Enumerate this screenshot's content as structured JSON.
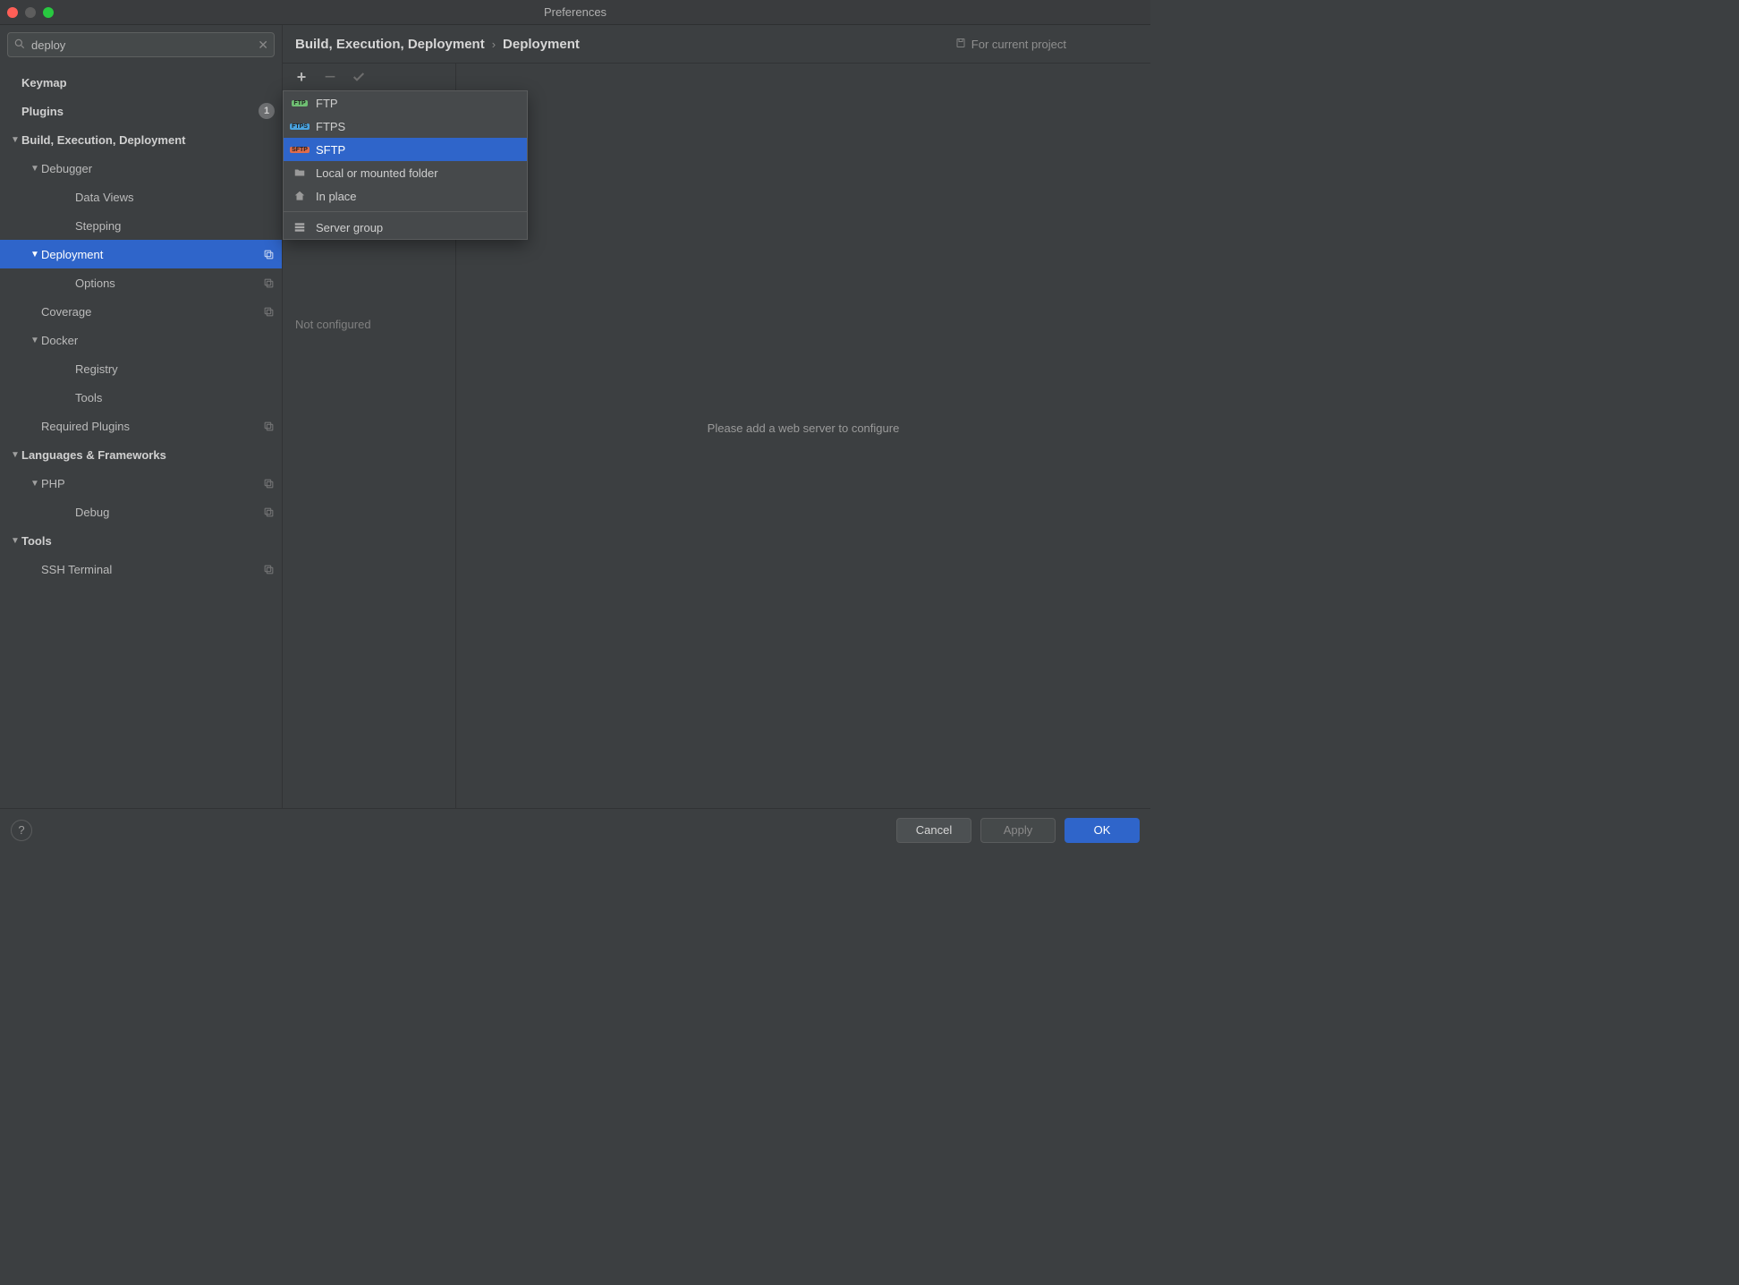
{
  "window": {
    "title": "Preferences"
  },
  "search": {
    "value": "deploy",
    "placeholder": ""
  },
  "sidebar": {
    "items": [
      {
        "label": "Keymap",
        "level": 0,
        "bold": true,
        "arrow": ""
      },
      {
        "label": "Plugins",
        "level": 0,
        "bold": true,
        "arrow": "",
        "badge": "1"
      },
      {
        "label": "Build, Execution, Deployment",
        "level": 0,
        "bold": true,
        "arrow": "▼"
      },
      {
        "label": "Debugger",
        "level": 1,
        "arrow": "▼"
      },
      {
        "label": "Data Views",
        "level": 2
      },
      {
        "label": "Stepping",
        "level": 2
      },
      {
        "label": "Deployment",
        "level": 1,
        "arrow": "▼",
        "selected": true,
        "copy": true
      },
      {
        "label": "Options",
        "level": 2,
        "copy": true
      },
      {
        "label": "Coverage",
        "level": 1,
        "copy": true
      },
      {
        "label": "Docker",
        "level": 1,
        "arrow": "▼"
      },
      {
        "label": "Registry",
        "level": 2
      },
      {
        "label": "Tools",
        "level": 2
      },
      {
        "label": "Required Plugins",
        "level": 1,
        "copy": true
      },
      {
        "label": "Languages & Frameworks",
        "level": 0,
        "bold": true,
        "arrow": "▼"
      },
      {
        "label": "PHP",
        "level": 1,
        "arrow": "▼",
        "copy": true
      },
      {
        "label": "Debug",
        "level": 2,
        "copy": true
      },
      {
        "label": "Tools",
        "level": 0,
        "bold": true,
        "arrow": "▼"
      },
      {
        "label": "SSH Terminal",
        "level": 1,
        "copy": true
      }
    ]
  },
  "breadcrumb": {
    "parent": "Build, Execution, Deployment",
    "current": "Deployment"
  },
  "scope": {
    "label": "For current project"
  },
  "list": {
    "not_configured": "Not configured"
  },
  "detail": {
    "message": "Please add a web server to configure"
  },
  "popup": {
    "items": [
      {
        "label": "FTP",
        "icon": "ftp-icon",
        "color": "#6fbf73"
      },
      {
        "label": "FTPS",
        "icon": "ftps-icon",
        "color": "#4aa3df"
      },
      {
        "label": "SFTP",
        "icon": "sftp-icon",
        "color": "#e06c4c",
        "selected": true
      },
      {
        "label": "Local or mounted folder",
        "icon": "folder-icon"
      },
      {
        "label": "In place",
        "icon": "home-icon"
      }
    ],
    "group_label": "Server group"
  },
  "footer": {
    "cancel": "Cancel",
    "apply": "Apply",
    "ok": "OK"
  }
}
